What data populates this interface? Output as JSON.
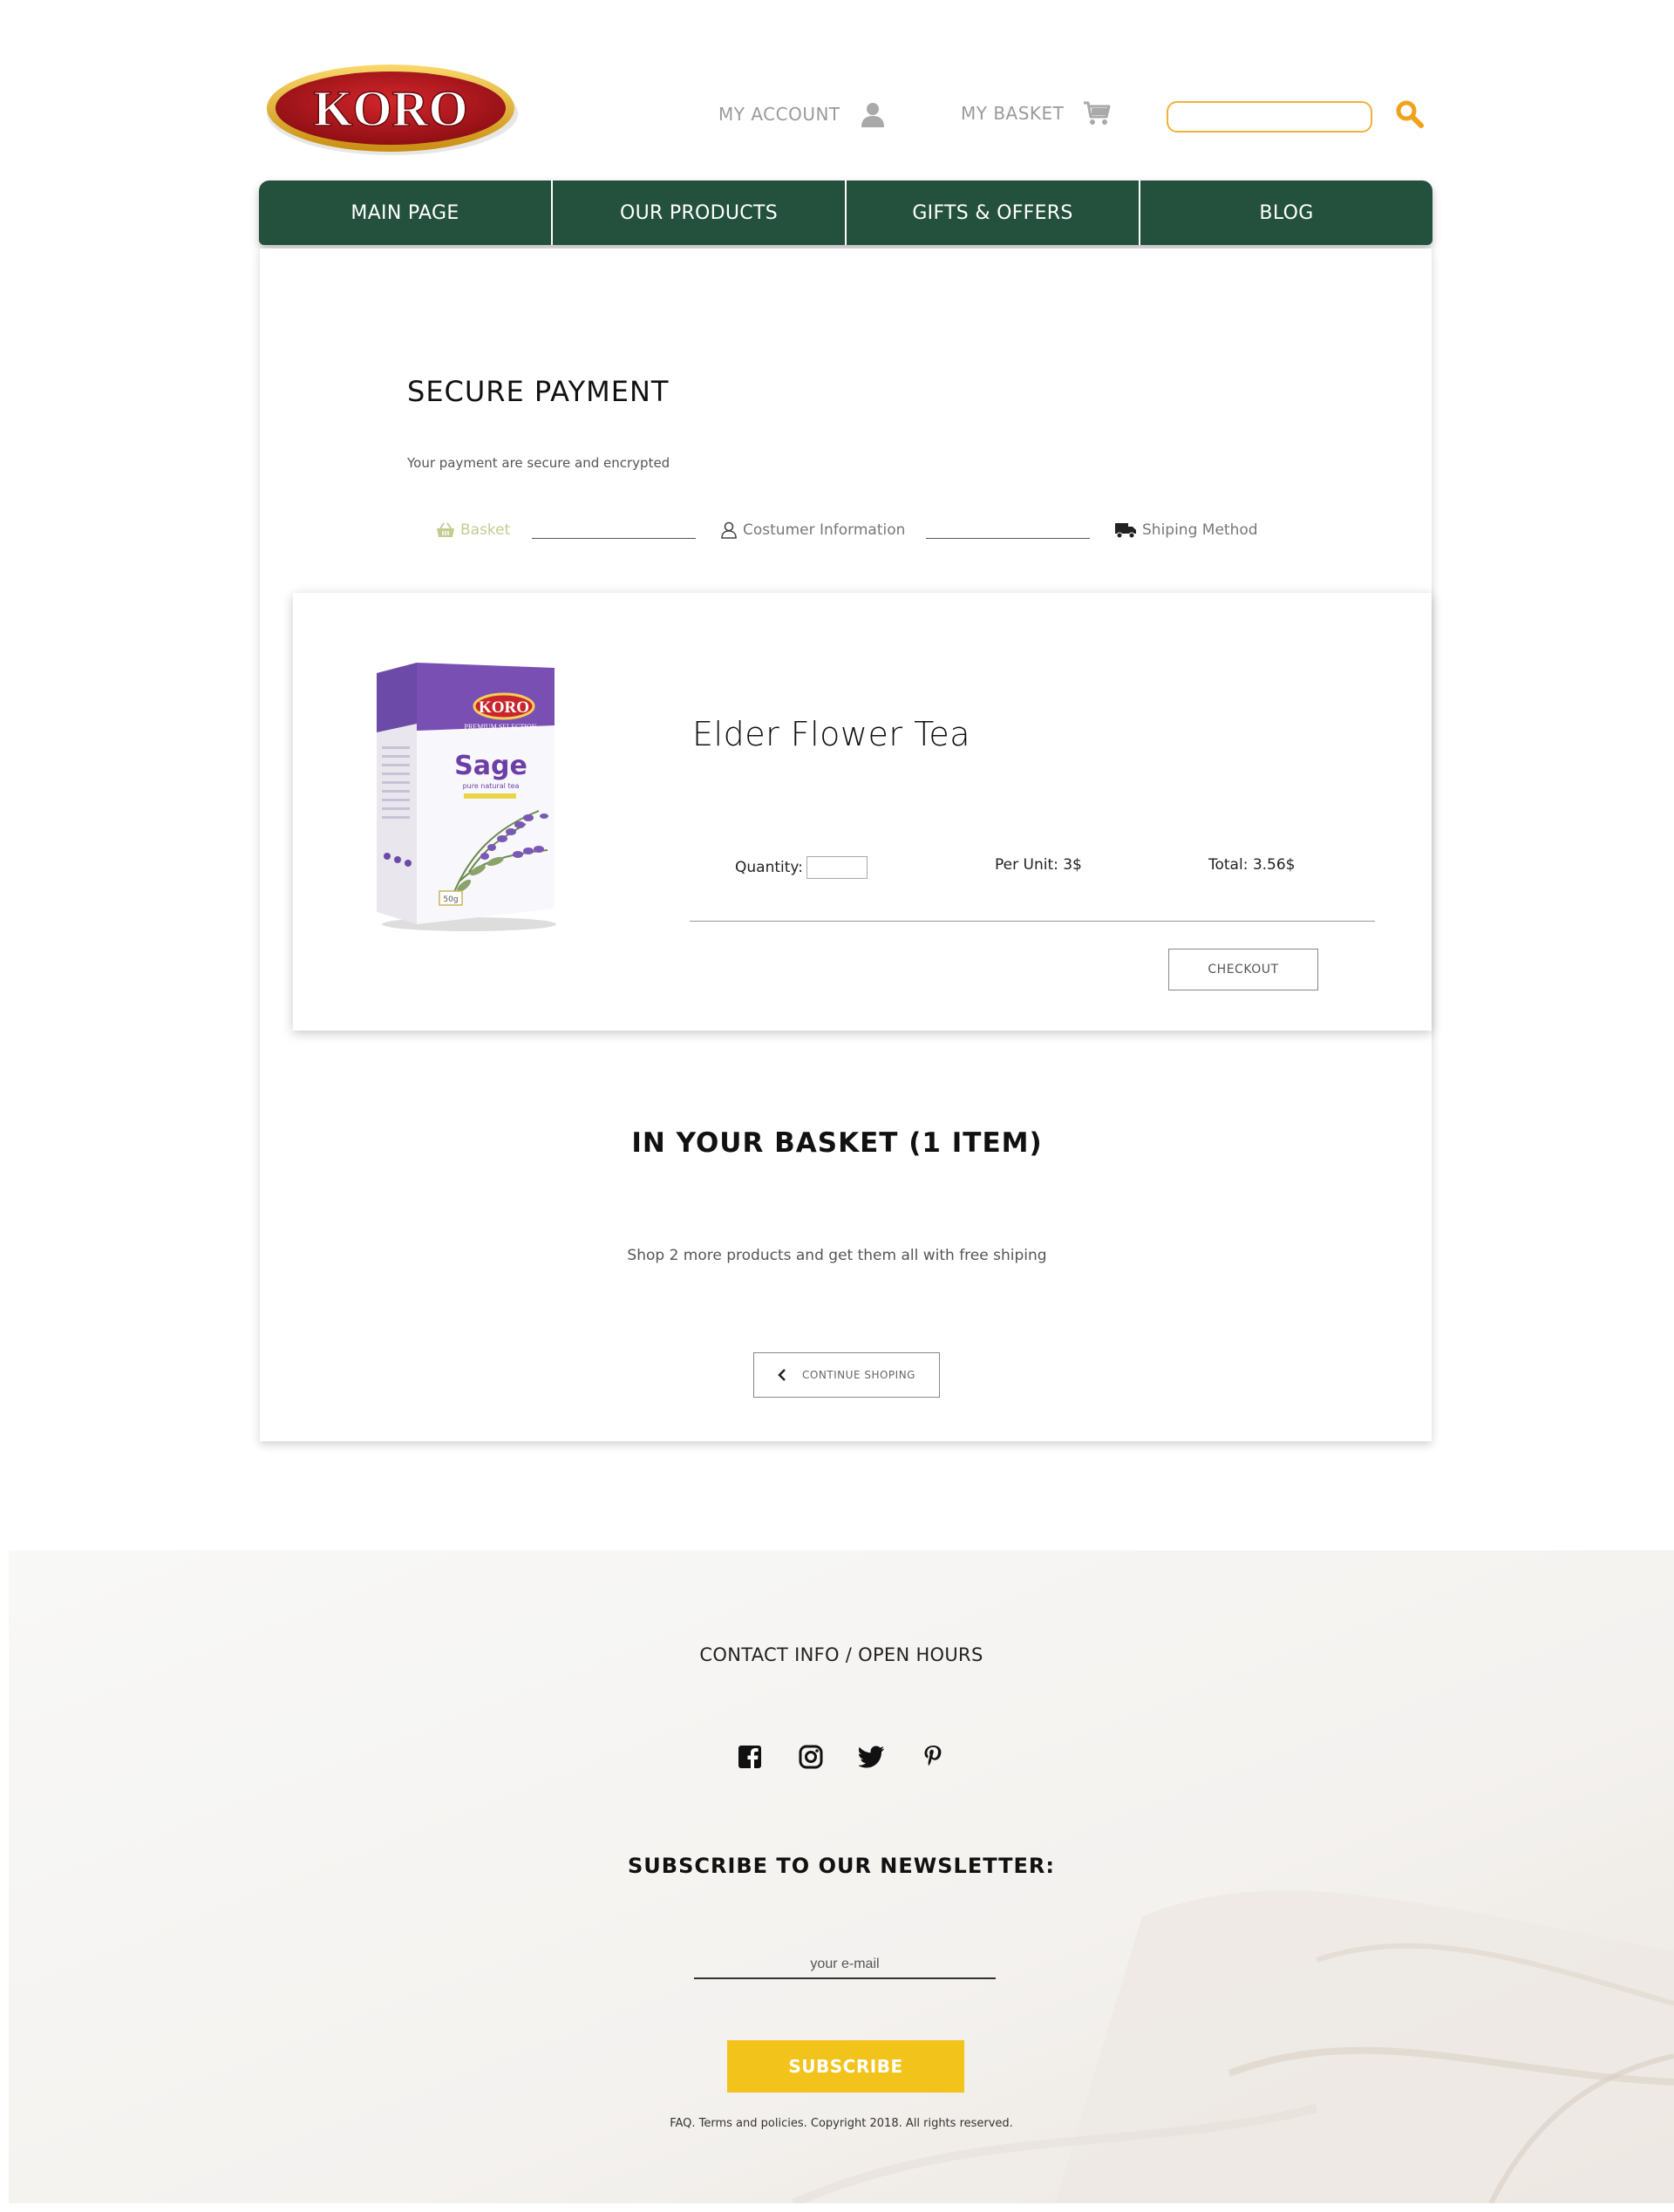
{
  "brand": {
    "logo_text": "KORO"
  },
  "header": {
    "account_label": "MY ACCOUNT",
    "basket_label": "MY BASKET",
    "search_placeholder": ""
  },
  "nav": {
    "items": [
      {
        "label": "MAIN PAGE"
      },
      {
        "label": "OUR PRODUCTS"
      },
      {
        "label": "GIFTS & OFFERS"
      },
      {
        "label": "BLOG"
      }
    ]
  },
  "checkout": {
    "title": "SECURE PAYMENT",
    "subtitle": "Your payment are secure and encrypted",
    "steps": [
      {
        "label": "Basket",
        "icon": "basket-icon",
        "active": true
      },
      {
        "label": "Costumer Information",
        "icon": "user-icon",
        "active": false
      },
      {
        "label": "Shiping Method",
        "icon": "truck-icon",
        "active": false
      }
    ]
  },
  "product": {
    "name": "Elder Flower Tea",
    "image_text": {
      "brand": "KORO",
      "line": "PREMIUM SELECTION",
      "name": "Sage",
      "tagline": "pure natural tea",
      "weight": "50g"
    },
    "quantity_label": "Quantity:",
    "quantity_value": "",
    "per_unit": "Per Unit: 3$",
    "total": "Total: 3.56$",
    "checkout_label": "CHECKOUT"
  },
  "basket": {
    "title": "IN YOUR BASKET (1 ITEM)",
    "promo": "Shop 2 more products and get them all with free shiping",
    "continue_label": "CONTINUE SHOPING"
  },
  "footer": {
    "contact": "CONTACT INFO / OPEN HOURS",
    "socials": [
      "facebook-icon",
      "instagram-icon",
      "twitter-icon",
      "pinterest-icon"
    ],
    "newsletter_title": "SUBSCRIBE TO OUR NEWSLETTER:",
    "email_placeholder": "your e-mail",
    "subscribe_label": "SUBSCRIBE",
    "legal": "FAQ. Terms and policies. Copyright 2018. All rights reserved."
  },
  "colors": {
    "nav_green": "#23513e",
    "accent_orange": "#f0b23a",
    "subscribe_yellow": "#f2c31b",
    "step_active": "#c5cb8f"
  }
}
